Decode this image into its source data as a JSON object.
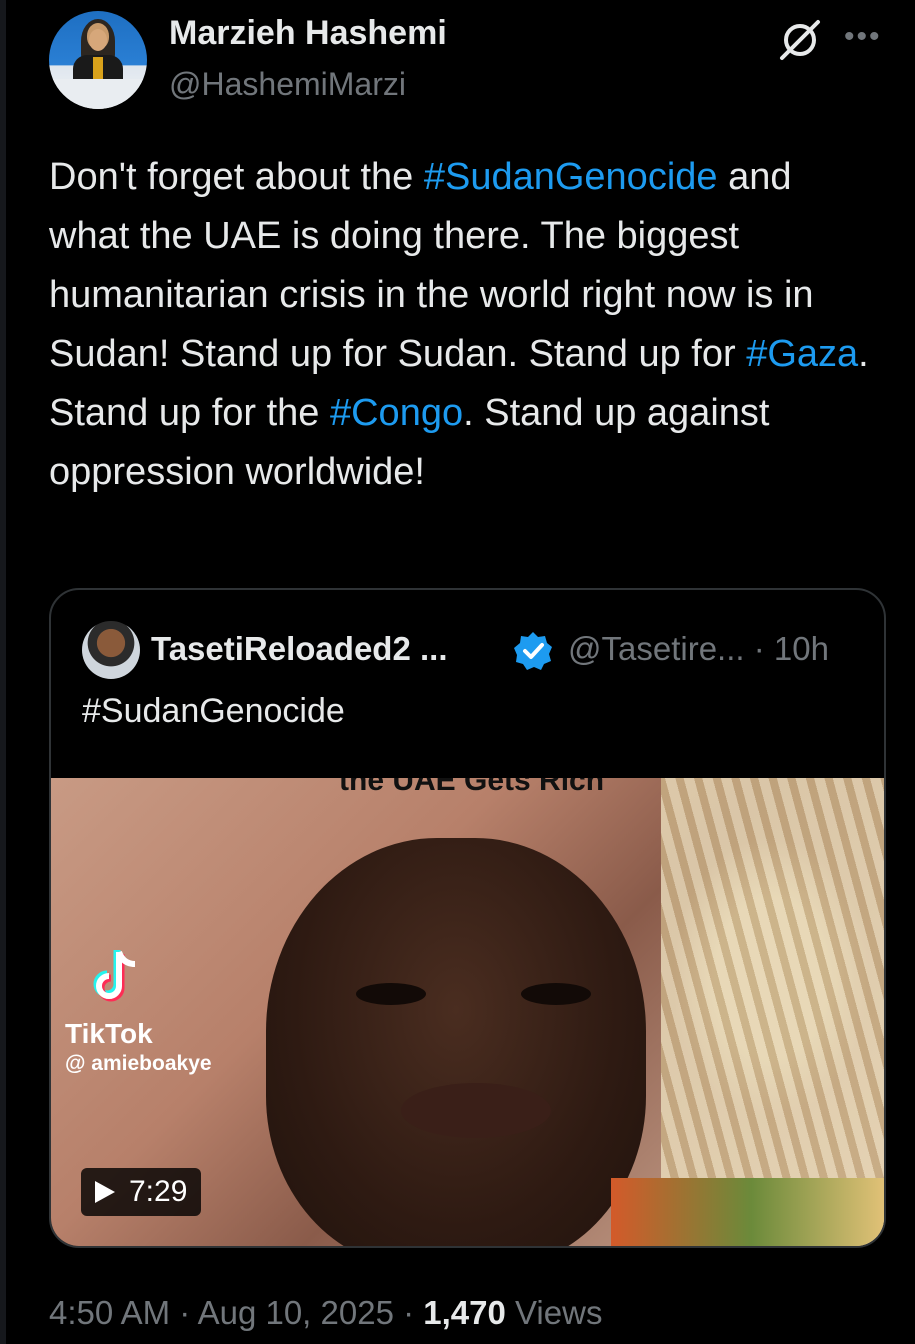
{
  "author": {
    "name": "Marzieh Hashemi",
    "handle": "@HashemiMarzi"
  },
  "tweet": {
    "p1": "Don't forget about the ",
    "tag1": "#SudanGenocide",
    "p2": " and what the UAE is doing there. The biggest humanitarian crisis in the world right now is in Sudan! Stand up for Sudan. Stand up for ",
    "tag2": "#Gaza",
    "p3": ". Stand up for the ",
    "tag3": "#Congo",
    "p4": ". Stand up against oppression worldwide!"
  },
  "quote": {
    "name": "TasetiReloaded2 ...",
    "handle": "@Tasetire... · 10h",
    "text": "#SudanGenocide",
    "video": {
      "caption": "the UAE Gets Rich",
      "watermark_brand": "TikTok",
      "watermark_user": "@ amieboakye",
      "duration": "7:29"
    }
  },
  "meta": {
    "time_date": "4:50 AM · Aug 10, 2025 · ",
    "views_count": "1,470",
    "views_label": " Views"
  },
  "colors": {
    "background": "#000000",
    "text": "#e7e9ea",
    "secondary": "#71767b",
    "link": "#1d9bf0",
    "border": "#2f3336"
  },
  "icons": [
    "grok-icon",
    "more-icon",
    "verified-badge-icon",
    "tiktok-logo-icon",
    "play-icon"
  ]
}
